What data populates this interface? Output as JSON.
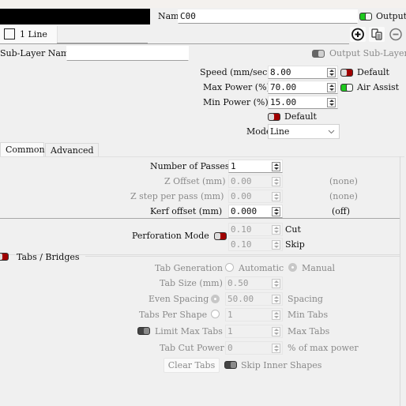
{
  "header": {
    "name_label": "Name",
    "name_value": "C00",
    "output_label": "Output",
    "output_on": true
  },
  "sublayer_tab": {
    "label": "1 Line"
  },
  "toolbar": {
    "add_icon": "plus-circle-icon",
    "copy_icon": "copy-icon",
    "remove_icon": "minus-circle-icon"
  },
  "sublayer": {
    "name_label": "Sub-Layer Name",
    "name_value": "",
    "output_label": "Output Sub-Layer"
  },
  "params": {
    "speed_label": "Speed (mm/sec)",
    "speed_value": "8.00",
    "speed_default_label": "Default",
    "max_power_label": "Max Power (%)",
    "max_power_value": "70.00",
    "air_assist_label": "Air Assist",
    "min_power_label": "Min Power (%)",
    "min_power_value": "15.00",
    "power_default_label": "Default",
    "mode_label": "Mode",
    "mode_value": "Line"
  },
  "tabs": [
    {
      "label": "Common",
      "active": true
    },
    {
      "label": "Advanced",
      "active": false
    }
  ],
  "common": {
    "passes_label": "Number of Passes",
    "passes_value": "1",
    "z_offset_label": "Z Offset (mm)",
    "z_offset_value": "0.00",
    "z_offset_status": "(none)",
    "z_step_label": "Z step per pass (mm)",
    "z_step_value": "0.00",
    "z_step_status": "(none)",
    "kerf_label": "Kerf offset (mm)",
    "kerf_value": "0.000",
    "kerf_status": "(off)"
  },
  "perforation": {
    "label": "Perforation Mode",
    "cut_value": "0.10",
    "cut_label": "Cut",
    "skip_value": "0.10",
    "skip_label": "Skip"
  },
  "tabs_bridges": {
    "title": "Tabs / Bridges",
    "generation_label": "Tab Generation",
    "automatic_label": "Automatic",
    "manual_label": "Manual",
    "tab_size_label": "Tab Size (mm)",
    "tab_size_value": "0.50",
    "even_spacing_label": "Even Spacing",
    "even_spacing_value": "50.00",
    "spacing_label": "Spacing",
    "tabs_per_shape_label": "Tabs Per Shape",
    "tabs_per_shape_value": "1",
    "min_tabs_label": "Min Tabs",
    "limit_max_label": "Limit Max Tabs",
    "limit_max_value": "1",
    "max_tabs_label": "Max Tabs",
    "cut_power_label": "Tab Cut Power",
    "cut_power_value": "0",
    "cut_power_unit": "% of max power",
    "clear_tabs_label": "Clear Tabs",
    "skip_inner_label": "Skip Inner Shapes"
  }
}
